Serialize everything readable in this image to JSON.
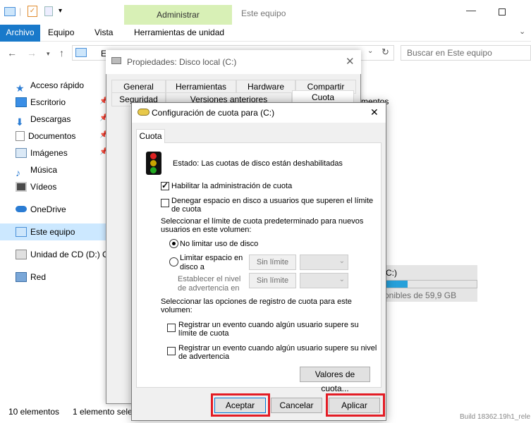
{
  "explorer": {
    "title_bar": {
      "context_tab": "Administrar",
      "window_title": "Este equipo"
    },
    "ribbon": {
      "tabs": [
        "Archivo",
        "Equipo",
        "Vista"
      ],
      "context_subtab": "Herramientas de unidad"
    },
    "address": {
      "partial": "Est",
      "search_placeholder": "Buscar en Este equipo"
    },
    "sidebar": {
      "items": [
        {
          "label": "Acceso rápido",
          "icon": "star-icon"
        },
        {
          "label": "Escritorio",
          "icon": "desktop-icon"
        },
        {
          "label": "Descargas",
          "icon": "download-icon"
        },
        {
          "label": "Documentos",
          "icon": "documents-icon"
        },
        {
          "label": "Imágenes",
          "icon": "pictures-icon"
        },
        {
          "label": "Música",
          "icon": "music-icon"
        },
        {
          "label": "Vídeos",
          "icon": "videos-icon"
        },
        {
          "label": "OneDrive",
          "icon": "cloud-icon"
        },
        {
          "label": "Este equipo",
          "icon": "computer-icon"
        },
        {
          "label": "Unidad de CD (D:) Cl",
          "icon": "cd-drive-icon"
        },
        {
          "label": "Red",
          "icon": "network-icon"
        }
      ]
    },
    "content": {
      "partial_heading": "mentos",
      "drive_label": "C:)",
      "drive_free": "onibles de 59,9 GB",
      "drive_used_fraction": 0.25
    },
    "status": {
      "count": "10 elementos",
      "selected": "1 elemento sele",
      "build": "Build 18362.19h1_rele"
    }
  },
  "properties": {
    "title": "Propiedades: Disco local (C:)",
    "tabs_row1": [
      "General",
      "Herramientas",
      "Hardware",
      "Compartir"
    ],
    "tabs_row2": [
      "Seguridad",
      "Versiones anteriores",
      "Cuota"
    ]
  },
  "quota": {
    "title": "Configuración de cuota para  (C:)",
    "tab": "Cuota",
    "status": "Estado:  Las cuotas de disco están deshabilitadas",
    "enable_label": "Habilitar la administración de cuota",
    "deny_label_1": "Denegar espacio en disco a usuarios que superen el límite",
    "deny_label_2": "de cuota",
    "select_limit_1": "Seleccionar el límite de cuota predeterminado para nuevos",
    "select_limit_2": "usuarios en este volumen:",
    "no_limit": "No limitar uso de disco",
    "limit_1": "Limitar espacio en",
    "limit_2": "disco a",
    "no_limit_value": "Sin límite",
    "warn_1": "Establecer el nivel",
    "warn_2": "de advertencia en",
    "log_heading_1": "Seleccionar las opciones de registro de cuota para este",
    "log_heading_2": "volumen:",
    "log_exceed_1": "Registrar un evento cuando algún usuario supere su",
    "log_exceed_2": "límite de cuota",
    "log_warn_1": "Registrar un evento cuando algún usuario supere su nivel",
    "log_warn_2": "de advertencia",
    "entries_button": "Valores de cuota...",
    "ok": "Aceptar",
    "cancel": "Cancelar",
    "apply": "Aplicar",
    "enable_checked": true,
    "deny_checked": false,
    "no_limit_selected": true
  },
  "colors": {
    "accent": "#1979ca",
    "context": "#d8f0b6",
    "highlight": "#e31c25",
    "selection": "#cce8ff"
  }
}
